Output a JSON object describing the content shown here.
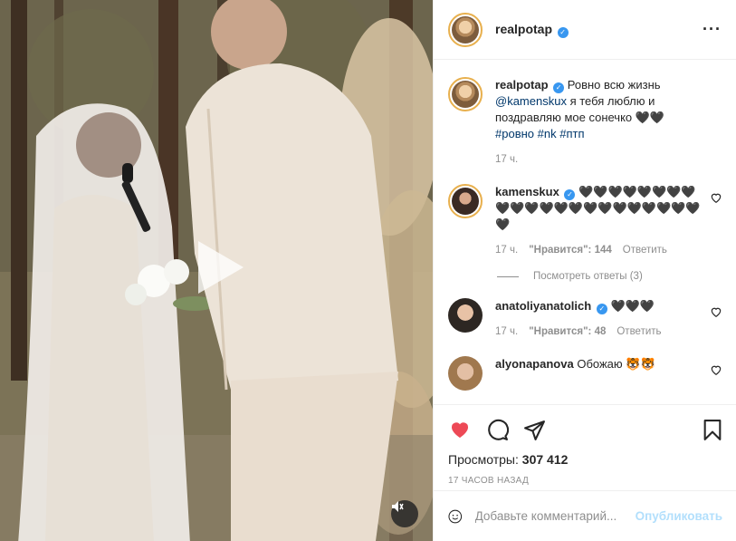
{
  "post": {
    "author": "realpotap",
    "caption": {
      "text_before": "Ровно всю жизнь",
      "mention": "@kamenskux",
      "text_after": "я тебя люблю и поздравляю мое сонечко 🖤🖤",
      "hashtags": [
        "#ровно",
        "#nk",
        "#птп"
      ],
      "time": "17 ч."
    },
    "comments": [
      {
        "user": "kamenskux",
        "verified": true,
        "text": "🖤🖤🖤🖤🖤🖤🖤🖤🖤🖤🖤🖤🖤🖤🖤🖤🖤🖤🖤🖤🖤🖤🖤",
        "time": "17 ч.",
        "likes": "\"Нравится\": 144",
        "reply": "Ответить",
        "view_replies": "Посмотреть ответы (3)"
      },
      {
        "user": "anatoliyanatolich",
        "verified": true,
        "text": "🖤🖤🖤",
        "time": "17 ч.",
        "likes": "\"Нравится\": 48",
        "reply": "Ответить"
      },
      {
        "user": "alyonapanova",
        "verified": false,
        "text": "Обожаю 🐯🐯",
        "time": "",
        "likes": "",
        "reply": ""
      }
    ],
    "views_label": "Просмотры:",
    "views_count": "307 412",
    "posted_ago": "17 часов назад",
    "liked": true
  },
  "add_comment": {
    "placeholder": "Добавьте комментарий...",
    "publish_label": "Опубликовать"
  },
  "colors": {
    "liked_heart": "#ed4956",
    "link": "#00376b",
    "verified": "#3897f0",
    "publish_disabled": "#b2dffc"
  },
  "icons": {
    "more": "more-horizontal-icon",
    "like": "heart-icon",
    "comment": "comment-bubble-icon",
    "share": "paper-plane-icon",
    "save": "bookmark-icon",
    "emoji": "smiley-icon",
    "play": "play-icon",
    "mute": "speaker-muted-icon"
  }
}
